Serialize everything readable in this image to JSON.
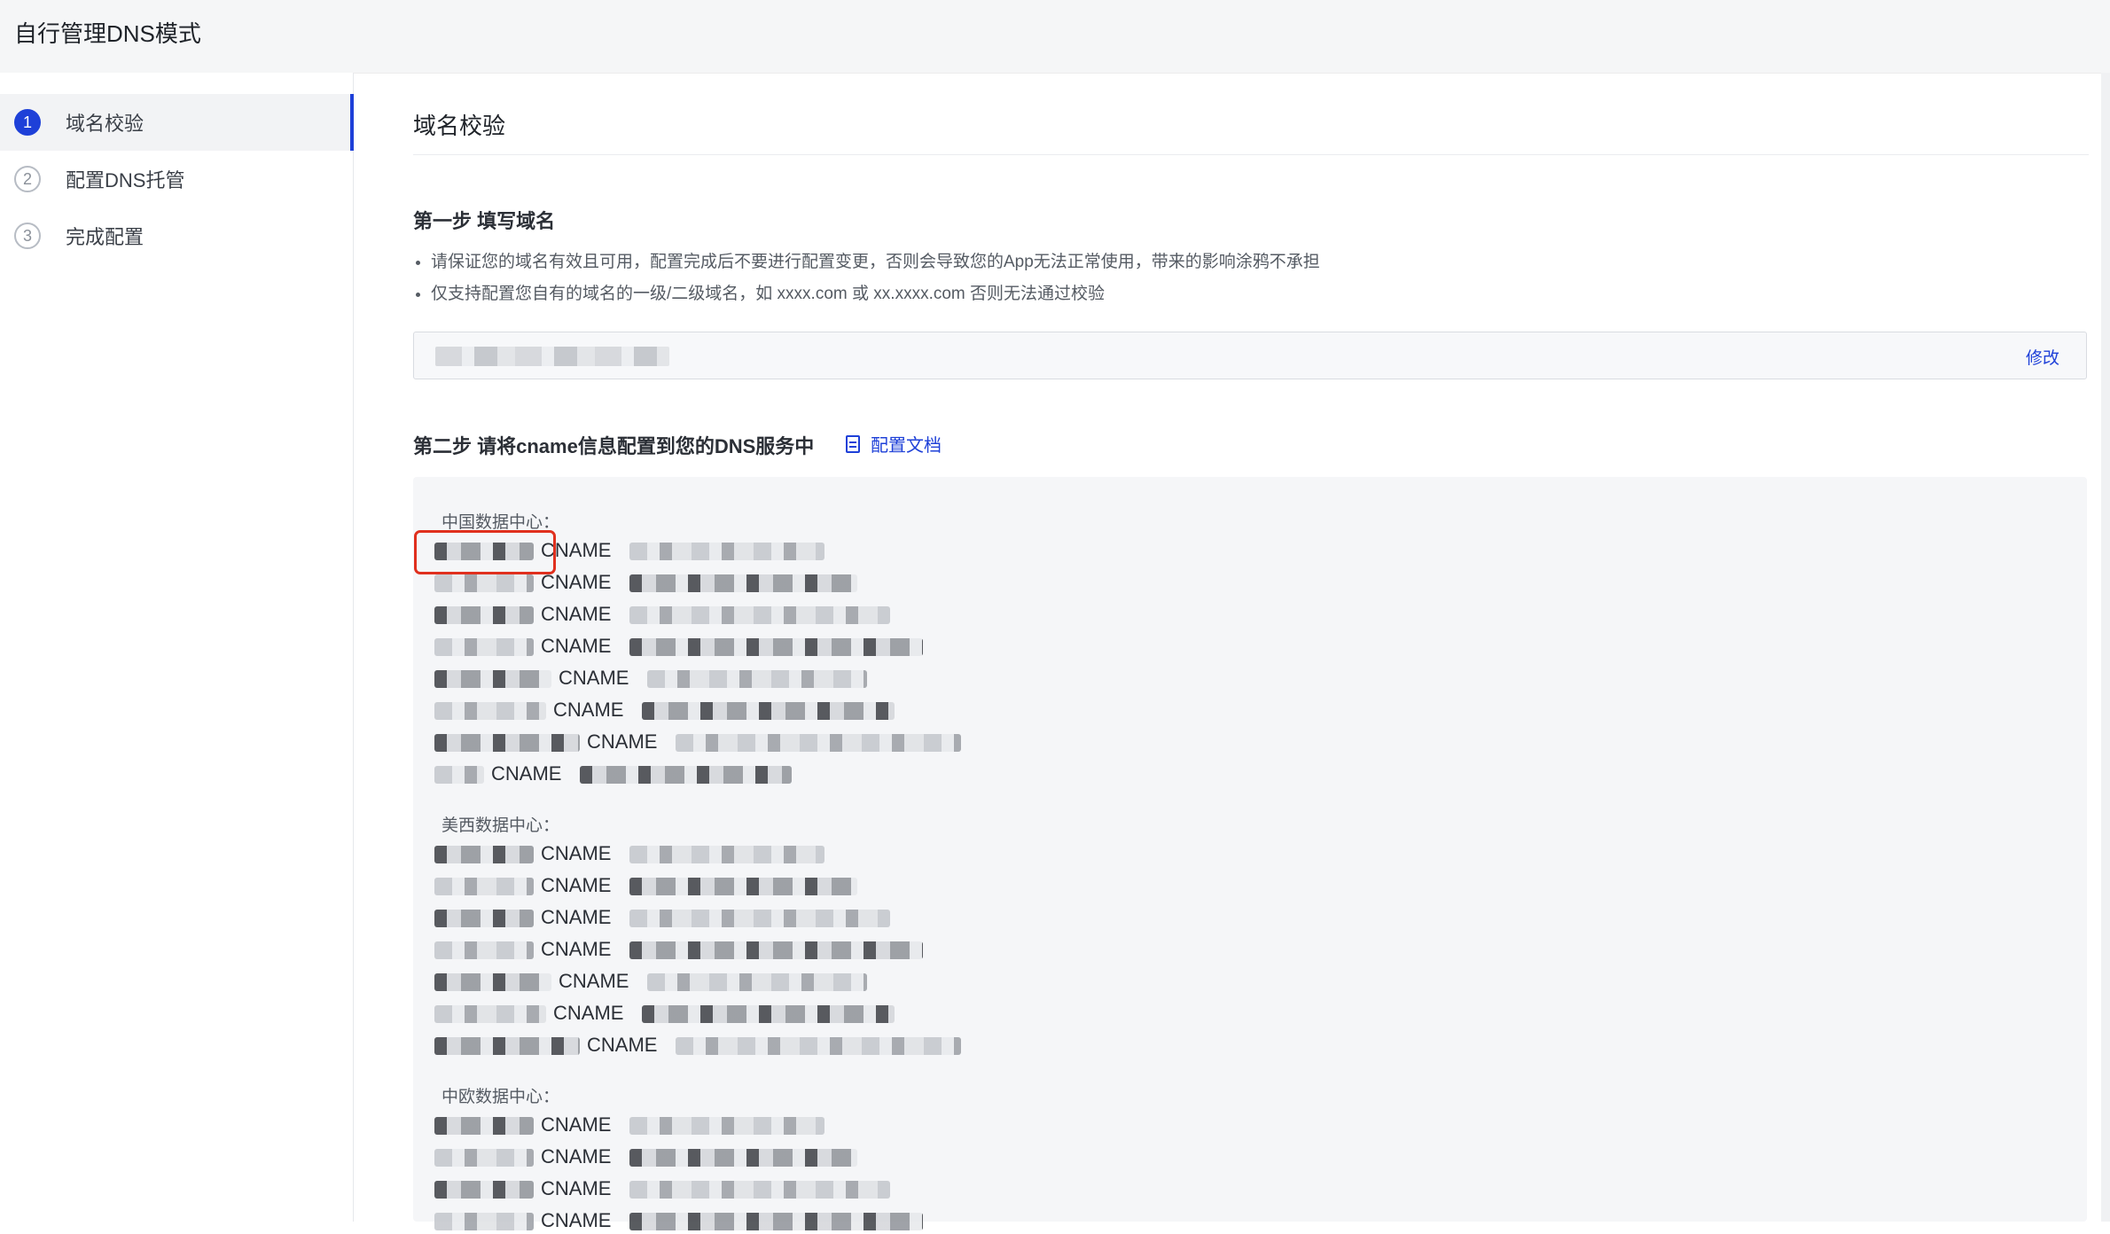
{
  "header": {
    "title": "自行管理DNS模式"
  },
  "sidebar": {
    "steps": [
      {
        "num": "1",
        "label": "域名校验"
      },
      {
        "num": "2",
        "label": "配置DNS托管"
      },
      {
        "num": "3",
        "label": "完成配置"
      }
    ]
  },
  "main": {
    "title": "域名校验",
    "step1": {
      "title": "第一步 填写域名",
      "bullets": [
        "请保证您的域名有效且可用，配置完成后不要进行配置变更，否则会导致您的App无法正常使用，带来的影响涂鸦不承担",
        "仅支持配置您自有的域名的一级/二级域名，如 xxxx.com 或 xx.xxxx.com 否则无法通过校验"
      ],
      "domain_value": "",
      "edit_label": "修改"
    },
    "step2": {
      "title": "第二步 请将cname信息配置到您的DNS服务中",
      "doc_link": "配置文档",
      "record_keyword": "CNAME",
      "datacenters": [
        {
          "title": "中国数据中心：",
          "record_count": 8
        },
        {
          "title": "美西数据中心：",
          "record_count": 7
        },
        {
          "title": "中欧数据中心：",
          "record_count": 4
        }
      ]
    }
  }
}
